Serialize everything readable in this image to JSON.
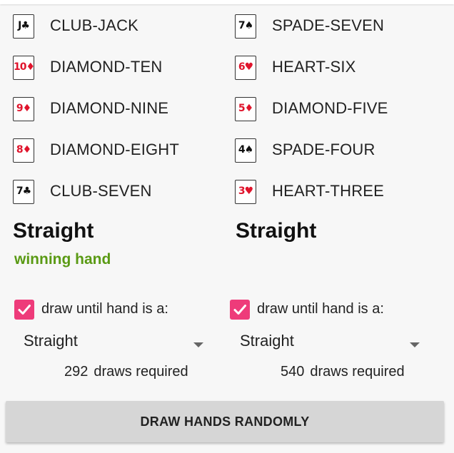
{
  "left_hand": {
    "cards": [
      {
        "rank": "J",
        "suit": "♣",
        "color": "black",
        "label": "CLUB-JACK"
      },
      {
        "rank": "10",
        "suit": "♦",
        "color": "red",
        "label": "DIAMOND-TEN"
      },
      {
        "rank": "9",
        "suit": "♦",
        "color": "red",
        "label": "DIAMOND-NINE"
      },
      {
        "rank": "8",
        "suit": "♦",
        "color": "red",
        "label": "DIAMOND-EIGHT"
      },
      {
        "rank": "7",
        "suit": "♣",
        "color": "black",
        "label": "CLUB-SEVEN"
      }
    ],
    "hand_name": "Straight",
    "result": "winning hand",
    "draw_until": {
      "checked": true,
      "label": "draw until hand is a:",
      "selected": "Straight"
    },
    "draws": {
      "count": "292",
      "label": "draws required"
    }
  },
  "right_hand": {
    "cards": [
      {
        "rank": "7",
        "suit": "♠",
        "color": "black",
        "label": "SPADE-SEVEN"
      },
      {
        "rank": "6",
        "suit": "♥",
        "color": "red",
        "label": "HEART-SIX"
      },
      {
        "rank": "5",
        "suit": "♦",
        "color": "red",
        "label": "DIAMOND-FIVE"
      },
      {
        "rank": "4",
        "suit": "♠",
        "color": "black",
        "label": "SPADE-FOUR"
      },
      {
        "rank": "3",
        "suit": "♥",
        "color": "red",
        "label": "HEART-THREE"
      }
    ],
    "hand_name": "Straight",
    "draw_until": {
      "checked": true,
      "label": "draw until hand is a:",
      "selected": "Straight"
    },
    "draws": {
      "count": "540",
      "label": "draws required"
    }
  },
  "draw_button_label": "DRAW HANDS RANDOMLY",
  "colors": {
    "winning": "#5a9a14",
    "checkbox": "#ee3b7a",
    "red_suit": "#e0142c",
    "button": "#d6d6d6"
  }
}
